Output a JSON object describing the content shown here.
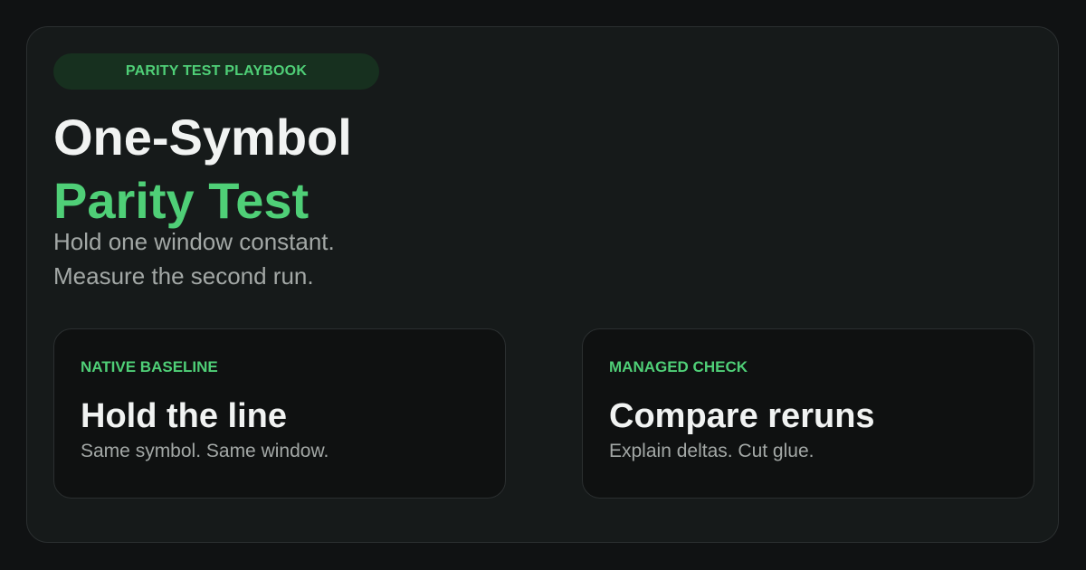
{
  "colors": {
    "background": "#101213",
    "card": "#161a1a",
    "panel": "#0f1111",
    "accent": "#4fcf77",
    "badge_bg": "#17301f",
    "title": "#f1f3f2",
    "muted": "#a3a8a6",
    "border": "#2b2f30"
  },
  "badge": "PARITY TEST PLAYBOOK",
  "title": {
    "line1": "One-Symbol",
    "line2": "Parity Test"
  },
  "subtitle": {
    "line1": "Hold one window constant.",
    "line2": "Measure the second run."
  },
  "panels": [
    {
      "kicker": "NATIVE BASELINE",
      "heading": "Hold the line",
      "text": "Same symbol. Same window."
    },
    {
      "kicker": "MANAGED CHECK",
      "heading": "Compare reruns",
      "text": "Explain deltas. Cut glue."
    }
  ]
}
